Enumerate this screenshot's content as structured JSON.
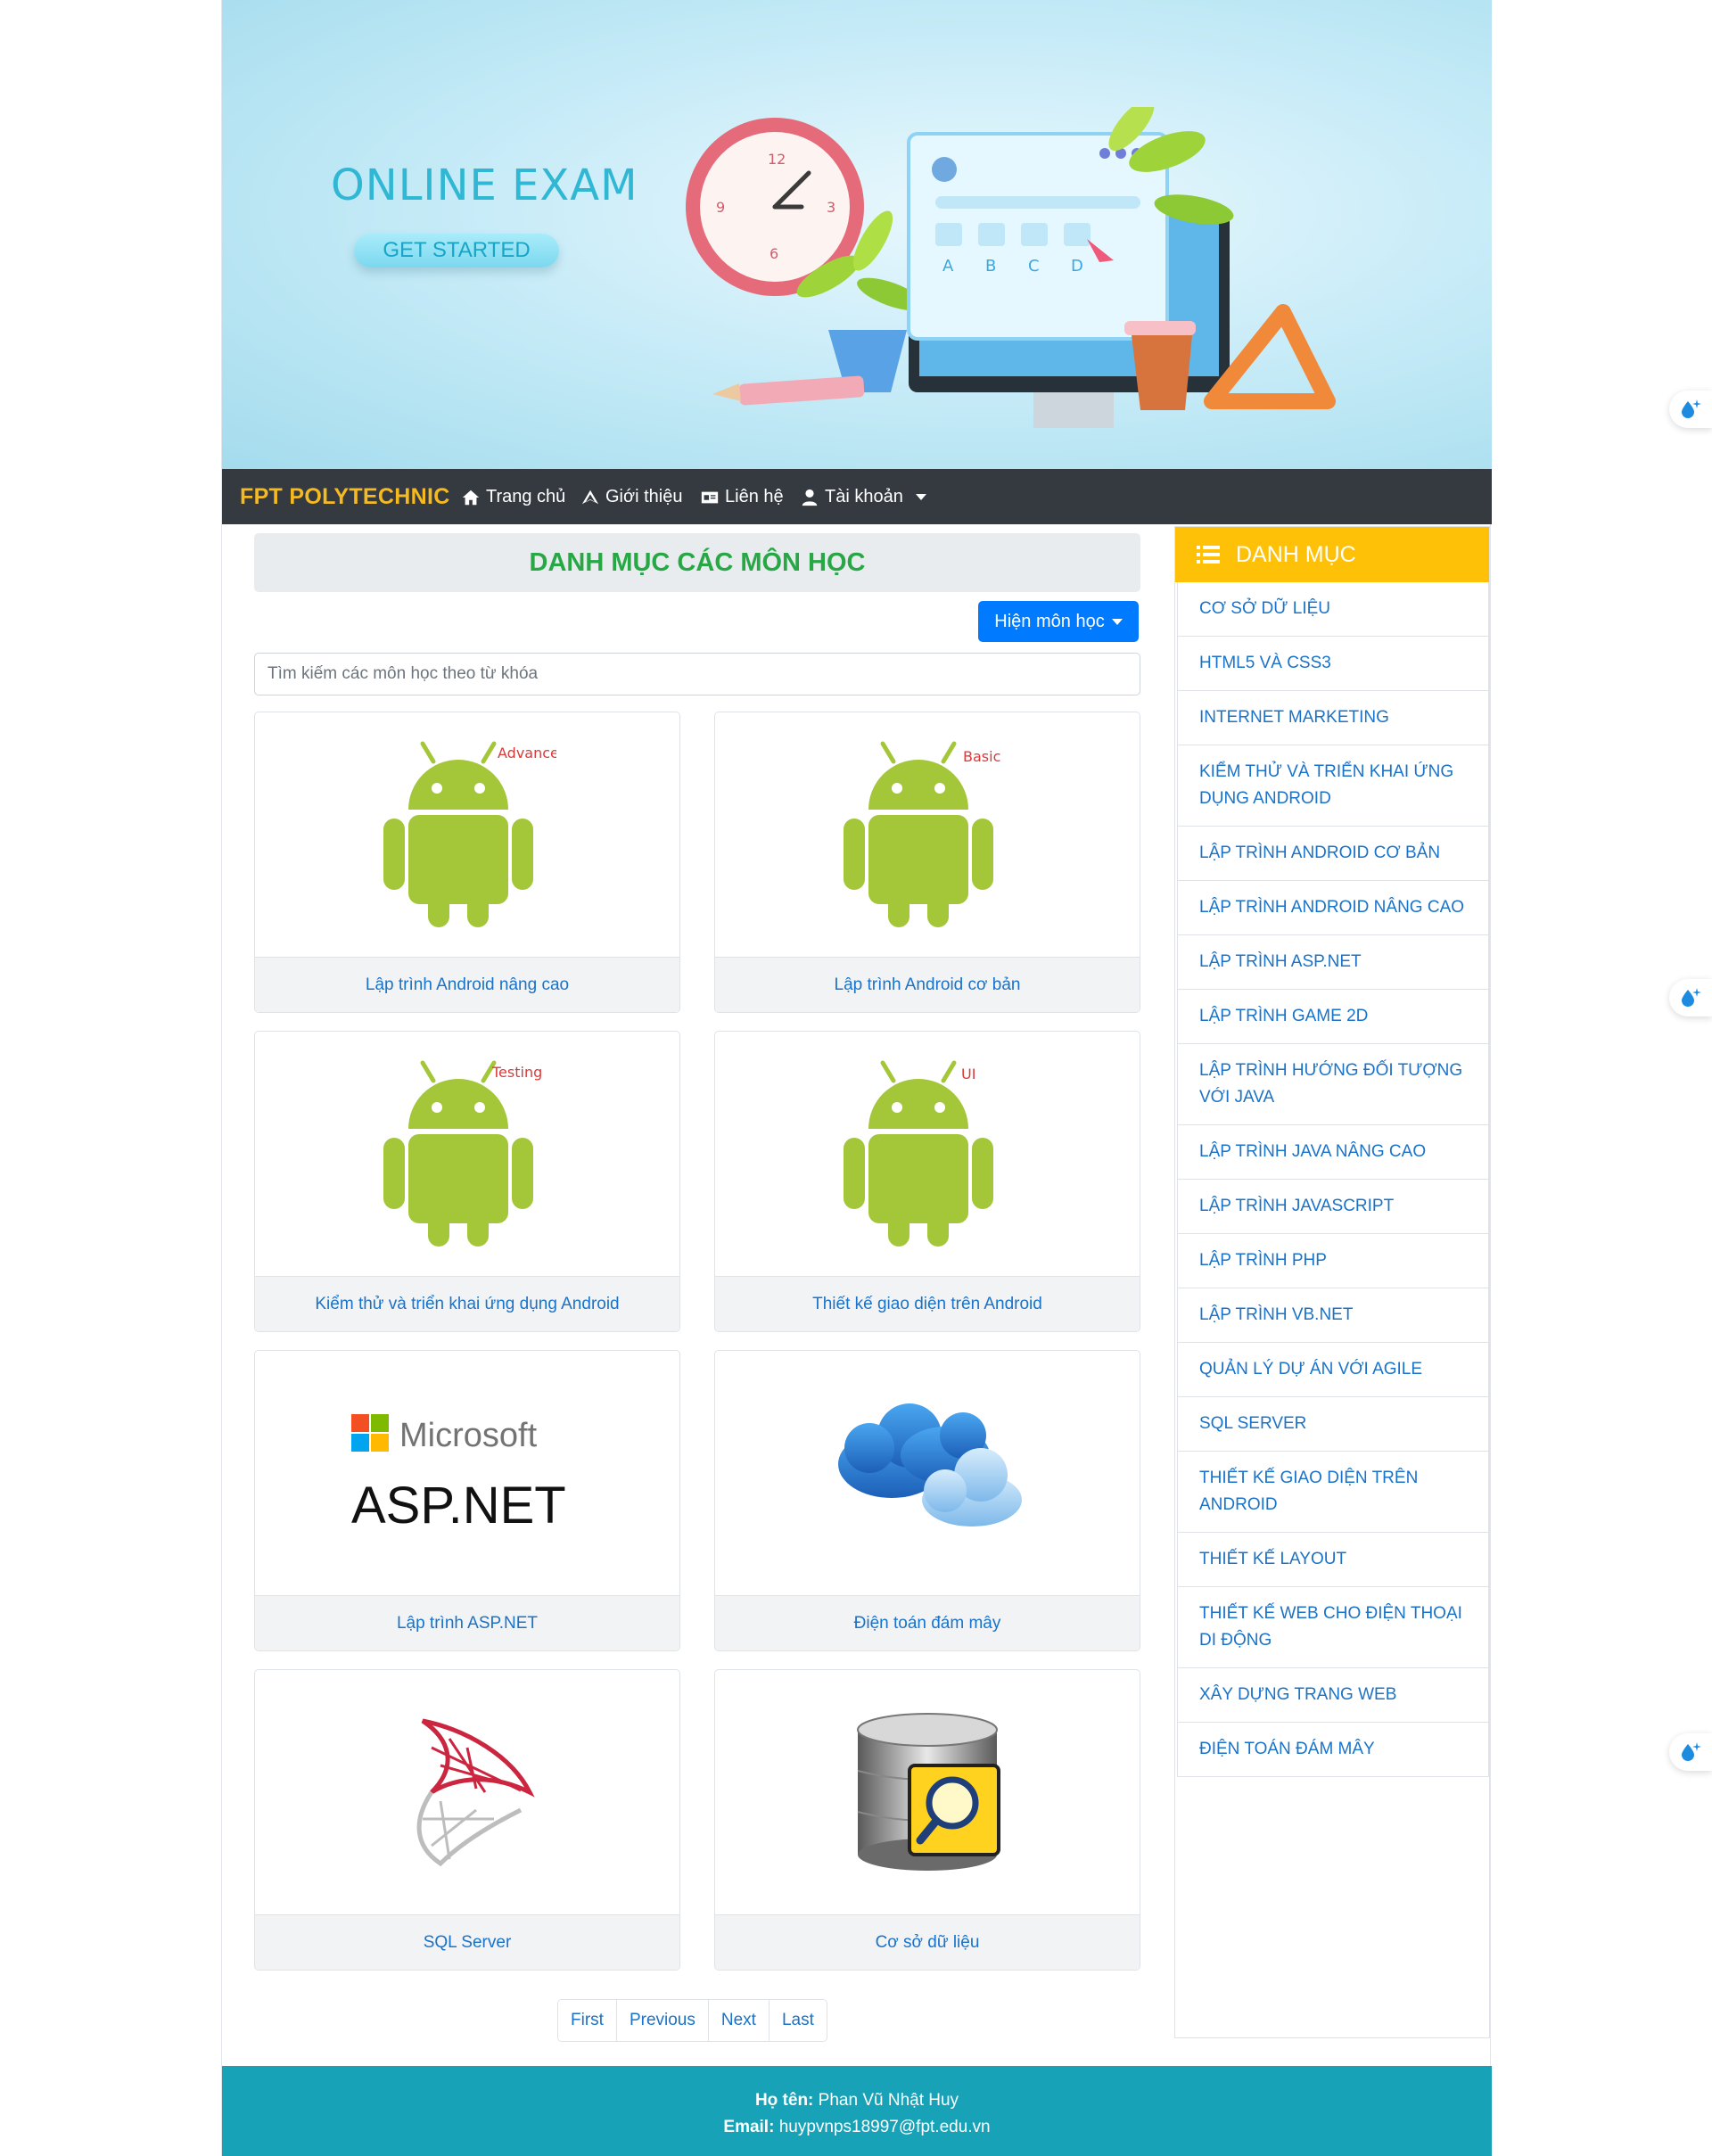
{
  "banner": {
    "title": "ONLINE EXAM",
    "button": "GET STARTED",
    "quiz_letters": [
      "A",
      "B",
      "C",
      "D"
    ],
    "clock_numbers": [
      "12",
      "3",
      "6",
      "9"
    ]
  },
  "navbar": {
    "brand": "FPT POLYTECHNIC",
    "items": [
      {
        "label": "Trang chủ",
        "icon": "home-icon"
      },
      {
        "label": "Giới thiệu",
        "icon": "plane-icon"
      },
      {
        "label": "Liên hệ",
        "icon": "id-card-icon"
      },
      {
        "label": "Tài khoản",
        "icon": "user-icon",
        "dropdown": true
      }
    ]
  },
  "main": {
    "heading": "DANH MỤC CÁC MÔN HỌC",
    "show_button": "Hiện môn học",
    "search_placeholder": "Tìm kiếm các môn học theo từ khóa",
    "courses": [
      {
        "title": "Lập trình Android nâng cao",
        "image": "android-logo",
        "tag": "Advance"
      },
      {
        "title": "Lập trình Android cơ bản",
        "image": "android-logo",
        "tag": "Basic"
      },
      {
        "title": "Kiểm thử và triển khai ứng dụng Android",
        "image": "android-logo",
        "tag": "Testing"
      },
      {
        "title": "Thiết kế giao diện trên Android",
        "image": "android-logo",
        "tag": "UI"
      },
      {
        "title": "Lập trình ASP.NET",
        "image": "microsoft-aspnet-logo",
        "logo_text_1": "Microsoft",
        "logo_text_2": "ASP.NET"
      },
      {
        "title": "Điện toán đám mây",
        "image": "cloud-icon"
      },
      {
        "title": "SQL Server",
        "image": "sql-server-logo"
      },
      {
        "title": "Cơ sở dữ liệu",
        "image": "database-search-icon"
      }
    ],
    "pagination": [
      "First",
      "Previous",
      "Next",
      "Last"
    ]
  },
  "sidebar": {
    "title": "DANH MỤC",
    "items": [
      "CƠ SỞ DỮ LIỆU",
      "HTML5 VÀ CSS3",
      "INTERNET MARKETING",
      "KIỂM THỬ VÀ TRIỂN KHAI ỨNG DỤNG ANDROID",
      "LẬP TRÌNH ANDROID CƠ BẢN",
      "LẬP TRÌNH ANDROID NÂNG CAO",
      "LẬP TRÌNH ASP.NET",
      "LẬP TRÌNH GAME 2D",
      "LẬP TRÌNH HƯỚNG ĐỐI TƯỢNG VỚI JAVA",
      "LẬP TRÌNH JAVA NÂNG CAO",
      "LẬP TRÌNH JAVASCRIPT",
      "LẬP TRÌNH PHP",
      "LẬP TRÌNH VB.NET",
      "QUẢN LÝ DỰ ÁN VỚI AGILE",
      "SQL SERVER",
      "THIẾT KẾ GIAO DIỆN TRÊN ANDROID",
      "THIẾT KẾ LAYOUT",
      "THIẾT KẾ WEB CHO ĐIỆN THOẠI DI ĐỘNG",
      "XÂY DỰNG TRANG WEB",
      "ĐIỆN TOÁN ĐÁM MÂY"
    ]
  },
  "footer": {
    "name_label": "Họ tên:",
    "name": "Phan Vũ Nhật Huy",
    "email_label": "Email:",
    "email": "huypvnps18997@fpt.edu.vn"
  },
  "colors": {
    "brand": "#f5b921",
    "navbar": "#343a40",
    "heading_green": "#28a745",
    "primary": "#007bff",
    "sidebar_head": "#ffc107",
    "footer": "#17a2b8",
    "link": "#1a73c9"
  }
}
